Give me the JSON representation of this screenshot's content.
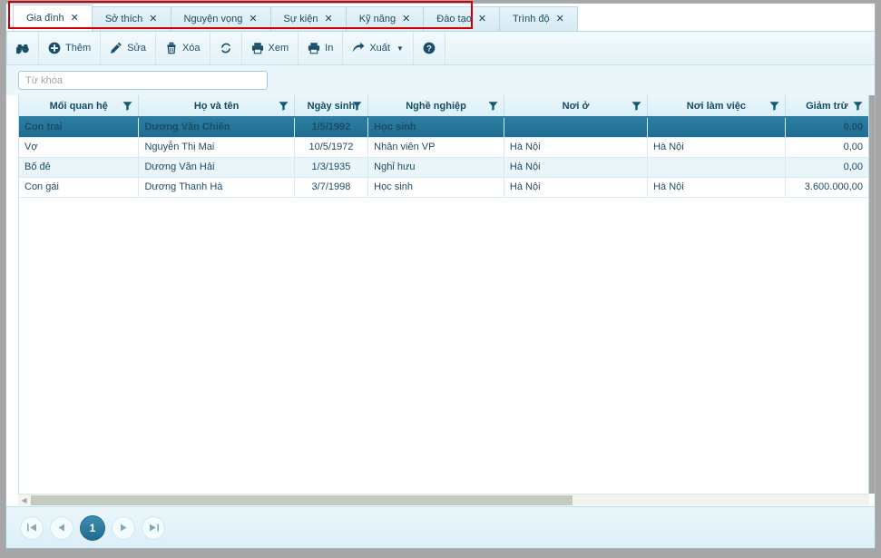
{
  "tabs": [
    {
      "label": "Gia đình",
      "close": "✕",
      "active": true
    },
    {
      "label": "Sở thích",
      "close": "✕",
      "active": false
    },
    {
      "label": "Nguyện vọng",
      "close": "✕",
      "active": false
    },
    {
      "label": "Sự kiện",
      "close": "✕",
      "active": false
    },
    {
      "label": "Kỹ năng",
      "close": "✕",
      "active": false
    },
    {
      "label": "Đào tạo",
      "close": "✕",
      "active": false
    },
    {
      "label": "Trình độ",
      "close": "✕",
      "active": false
    }
  ],
  "annotation": {
    "color": "#cc0000",
    "shape": "rectangle",
    "target": "tab-bar"
  },
  "toolbar": {
    "buttons": [
      {
        "name": "find",
        "icon": "binoculars-icon",
        "label": ""
      },
      {
        "name": "add",
        "icon": "plus-circle-icon",
        "label": "Thêm"
      },
      {
        "name": "edit",
        "icon": "pencil-icon",
        "label": "Sửa"
      },
      {
        "name": "delete",
        "icon": "trash-icon",
        "label": "Xóa"
      },
      {
        "name": "refresh",
        "icon": "refresh-icon",
        "label": ""
      },
      {
        "name": "preview",
        "icon": "printer-icon",
        "label": "Xem"
      },
      {
        "name": "print",
        "icon": "printer-icon",
        "label": "In"
      },
      {
        "name": "export",
        "icon": "arrow-export-icon",
        "label": "Xuất",
        "caret": "▼"
      },
      {
        "name": "help",
        "icon": "question-circle-icon",
        "label": ""
      }
    ]
  },
  "search": {
    "placeholder": "Từ khóa",
    "value": ""
  },
  "grid": {
    "columns": [
      {
        "key": "relation",
        "label": "Mối quan hệ",
        "align": "left",
        "width": "14.1%"
      },
      {
        "key": "fullname",
        "label": "Họ và tên",
        "align": "left",
        "width": "18.3%"
      },
      {
        "key": "dob",
        "label": "Ngày sinh",
        "align": "center",
        "width": "8.7%"
      },
      {
        "key": "job",
        "label": "Nghề nghiệp",
        "align": "left",
        "width": "16.0%"
      },
      {
        "key": "residence",
        "label": "Nơi ở",
        "align": "left",
        "width": "16.9%"
      },
      {
        "key": "workplace",
        "label": "Nơi làm việc",
        "align": "left",
        "width": "16.2%"
      },
      {
        "key": "deduction",
        "label": "Giảm trừ",
        "align": "right",
        "width": "9.8%"
      }
    ],
    "rows": [
      {
        "relation": "Con trai",
        "fullname": "Dương Văn Chiến",
        "dob": "1/5/1992",
        "job": "Học sinh",
        "residence": "",
        "workplace": "",
        "deduction": "0,00",
        "selected": true
      },
      {
        "relation": "Vợ",
        "fullname": "Nguyễn Thị Mai",
        "dob": "10/5/1972",
        "job": "Nhân viên VP",
        "residence": "Hà Nội",
        "workplace": "Hà Nội",
        "deduction": "0,00",
        "selected": false
      },
      {
        "relation": "Bố đẻ",
        "fullname": "Dương Văn Hải",
        "dob": "1/3/1935",
        "job": "Nghỉ hưu",
        "residence": "Hà Nội",
        "workplace": "",
        "deduction": "0,00",
        "selected": false
      },
      {
        "relation": "Con gái",
        "fullname": "Dương Thanh Hà",
        "dob": "3/7/1998",
        "job": "Học sinh",
        "residence": "Hà Nội",
        "workplace": "Hà Nội",
        "deduction": "3.600.000,00",
        "selected": false
      }
    ]
  },
  "pager": {
    "first": "⏮",
    "prev": "◀",
    "current": "1",
    "next": "▶",
    "last": "⏭"
  },
  "colors": {
    "accent": "#2d7ea3",
    "selected_row": "#2d7da2",
    "header_bg": "#e4f3fa",
    "alt_row": "#eaf5fa",
    "annotation": "#cc0000",
    "frame": "#a6a6a6"
  }
}
